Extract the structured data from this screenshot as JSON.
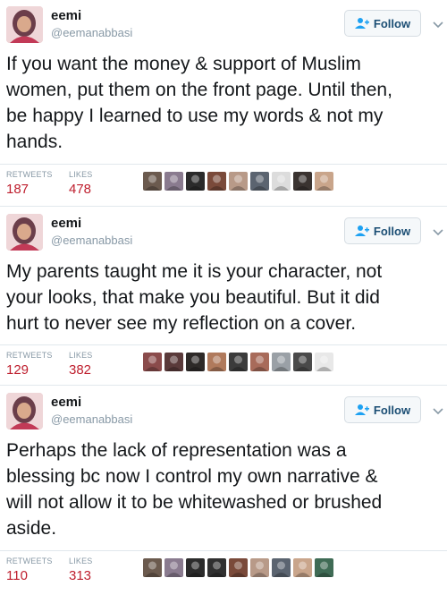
{
  "tweets": [
    {
      "name": "eemi",
      "handle": "@eemanabbasi",
      "follow_label": "Follow",
      "text": "If you want the money & support of Muslim\nwomen, put them on the front page. Until then,\nbe happy I learned to use my words & not my\nhands.",
      "retweets_label": "RETWEETS",
      "retweets": "187",
      "likes_label": "LIKES",
      "likes": "478",
      "liker_colors": [
        "#6b5a4e",
        "#8a7b8f",
        "#2b2b2b",
        "#7a4a3a",
        "#b89a88",
        "#5b6470",
        "#dcdcdc",
        "#3a3330",
        "#c9a58b"
      ]
    },
    {
      "name": "eemi",
      "handle": "@eemanabbasi",
      "follow_label": "Follow",
      "text": "My parents taught me it is your character, not\nyour looks, that make you beautiful. But it did\nhurt to never see my reflection on a cover.",
      "retweets_label": "RETWEETS",
      "retweets": "129",
      "likes_label": "LIKES",
      "likes": "382",
      "liker_colors": [
        "#8a4b4b",
        "#5a3a3a",
        "#2e2a28",
        "#b07a5c",
        "#3b3b3b",
        "#a86b5a",
        "#9aa0a6",
        "#4a4a4a",
        "#e8e8e8"
      ]
    },
    {
      "name": "eemi",
      "handle": "@eemanabbasi",
      "follow_label": "Follow",
      "text": "Perhaps the lack of representation was a\nblessing bc now I control my own narrative &\nwill not allow it to be whitewashed or brushed\naside.",
      "retweets_label": "RETWEETS",
      "retweets": "110",
      "likes_label": "LIKES",
      "likes": "313",
      "liker_colors": [
        "#6b5a4e",
        "#8a7b8f",
        "#2b2b2b",
        "#303030",
        "#7a4a3a",
        "#b89a88",
        "#5b6470",
        "#c9a58b",
        "#3f6b55"
      ]
    }
  ]
}
